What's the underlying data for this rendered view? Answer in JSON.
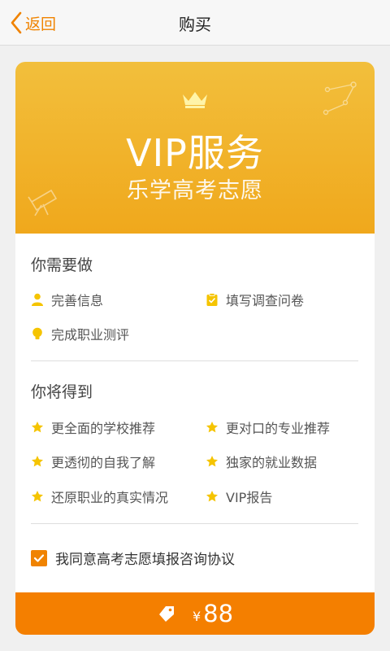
{
  "nav": {
    "back_label": "返回",
    "title": "购买"
  },
  "banner": {
    "title": "VIP服务",
    "subtitle": "乐学高考志愿"
  },
  "todo": {
    "heading": "你需要做",
    "items": [
      {
        "label": "完善信息",
        "icon": "user-icon"
      },
      {
        "label": "填写调查问卷",
        "icon": "clipboard-icon"
      },
      {
        "label": "完成职业测评",
        "icon": "lightbulb-icon"
      }
    ]
  },
  "benefits": {
    "heading": "你将得到",
    "items": [
      {
        "label": "更全面的学校推荐",
        "icon": "star-icon"
      },
      {
        "label": "更对口的专业推荐",
        "icon": "star-icon"
      },
      {
        "label": "更透彻的自我了解",
        "icon": "star-icon"
      },
      {
        "label": "独家的就业数据",
        "icon": "star-icon"
      },
      {
        "label": "还原职业的真实情况",
        "icon": "star-icon"
      },
      {
        "label": "VIP报告",
        "icon": "star-icon"
      }
    ]
  },
  "agreement": {
    "label": "我同意高考志愿填报咨询协议",
    "checked": true
  },
  "purchase": {
    "currency": "¥",
    "price": "88"
  },
  "colors": {
    "accent": "#f08300",
    "button": "#f47f00",
    "banner_top": "#f2bf3c",
    "banner_bottom": "#f0a81c",
    "icon_yellow": "#f5c400"
  }
}
